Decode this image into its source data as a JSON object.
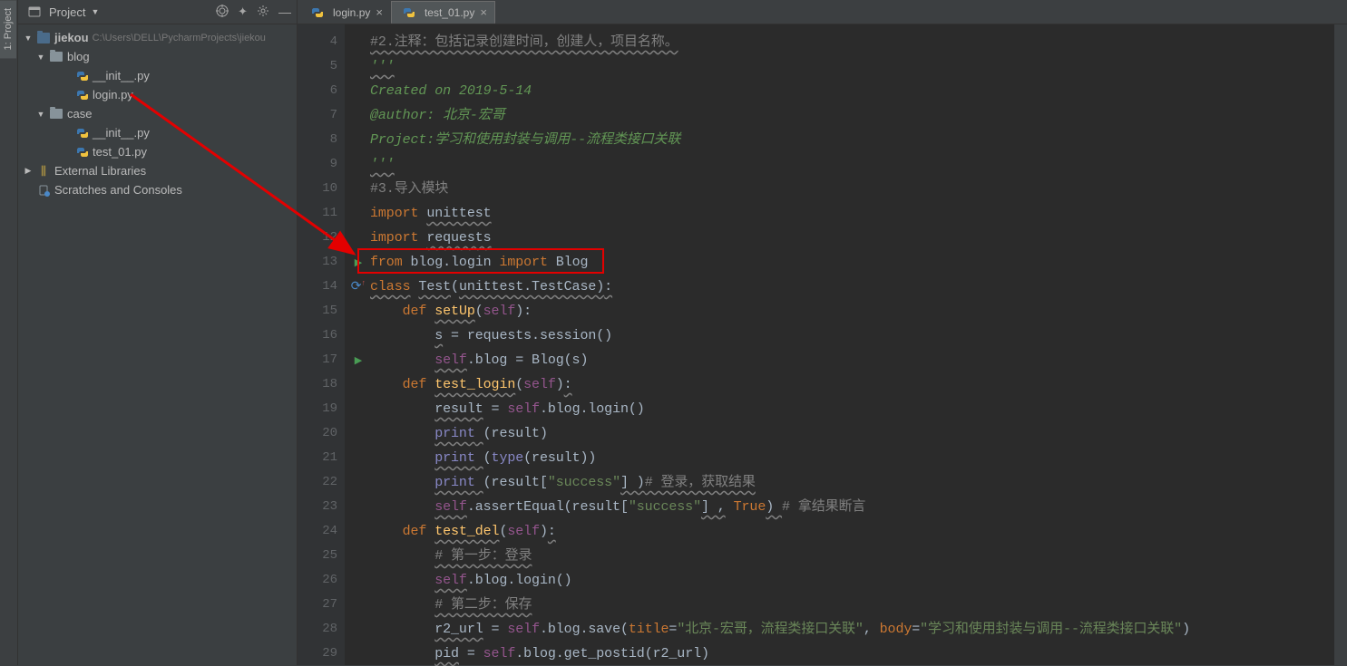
{
  "rail": {
    "projectLabel": "1: Project"
  },
  "projectHeader": {
    "title": "Project"
  },
  "tree": {
    "root": {
      "name": "jiekou",
      "path": "C:\\Users\\DELL\\PycharmProjects\\jiekou"
    },
    "blog": {
      "name": "blog",
      "files": [
        "__init__.py",
        "login.py"
      ]
    },
    "case": {
      "name": "case",
      "files": [
        "__init__.py",
        "test_01.py"
      ]
    },
    "external": "External Libraries",
    "scratches": "Scratches and Consoles"
  },
  "tabs": [
    {
      "label": "login.py",
      "active": false
    },
    {
      "label": "test_01.py",
      "active": true
    }
  ],
  "code": {
    "startLine": 4,
    "lines": [
      {
        "n": 4,
        "html": "<span class='c-comment wavy'>#2.注释：包括记录创建时间，创建人，项目名称。</span>"
      },
      {
        "n": 5,
        "html": "<span class='c-doc wavy'>'''</span>"
      },
      {
        "n": 6,
        "html": "<span class='c-doc'>Created on 2019-5-14</span>"
      },
      {
        "n": 7,
        "html": "<span class='c-doc'>@author: 北京-宏哥</span>"
      },
      {
        "n": 8,
        "html": "<span class='c-doc'>Project:学习和使用封装与调用--流程类接口关联</span>"
      },
      {
        "n": 9,
        "html": "<span class='c-doc wavy'>'''</span>"
      },
      {
        "n": 10,
        "html": "<span class='c-comment'>#3.导入模块</span>"
      },
      {
        "n": 11,
        "html": "<span class='c-kw'>import</span> <span class='c-text wavy'>unittest</span>"
      },
      {
        "n": 12,
        "html": "<span class='c-kw'>import</span> <span class='c-text wavy'>requests</span>"
      },
      {
        "n": 13,
        "html": "<span class='c-kw'>from</span> <span class='c-text'>blog.login</span> <span class='c-kw'>import</span> <span class='c-text'>Blog</span>"
      },
      {
        "n": 14,
        "html": "<span class='c-kw wavy'>class</span> <span class='c-text wavy'>Test</span><span class='c-text'>(</span><span class='c-text wavy'>unittest.TestCase)</span><span class='c-text wavy'>:</span>",
        "play": true
      },
      {
        "n": 15,
        "html": "    <span class='c-kw'>def</span> <span class='c-def wavy'>setUp</span><span class='c-text'>(</span><span class='c-self'>self</span><span class='c-text'>):</span>",
        "ovr": true
      },
      {
        "n": 16,
        "html": "        <span class='c-text wavy'>s</span> <span class='c-text'>= requests.session()</span>"
      },
      {
        "n": 17,
        "html": "        <span class='c-self wavy'>self</span><span class='c-text'>.blog = Blog(s)</span>"
      },
      {
        "n": 18,
        "html": "    <span class='c-kw'>def</span> <span class='c-def wavy'>test_login</span><span class='c-text'>(</span><span class='c-self'>self</span><span class='c-text'>)</span><span class='c-text wavy'>:</span>",
        "play": true
      },
      {
        "n": 19,
        "html": "        <span class='c-text wavy'>result</span> <span class='c-text'>= </span><span class='c-self'>self</span><span class='c-text'>.blog.login()</span>"
      },
      {
        "n": 20,
        "html": "        <span class='c-builtin wavy'>print</span><span class='c-text wavy'> </span><span class='c-text'>(result)</span>"
      },
      {
        "n": 21,
        "html": "        <span class='c-builtin wavy'>print</span><span class='c-text wavy'> </span><span class='c-text'>(</span><span class='c-builtin'>type</span><span class='c-text'>(result))</span>"
      },
      {
        "n": 22,
        "html": "        <span class='c-builtin wavy'>print</span><span class='c-text wavy'> </span><span class='c-text'>(result[</span><span class='c-str'>\"success\"</span><span class='c-text wavy'>] )</span><span class='c-comment wavy'># 登录，获取结果</span>"
      },
      {
        "n": 23,
        "html": "        <span class='c-self wavy'>self</span><span class='c-text'>.assertEqual(result[</span><span class='c-str'>\"success\"</span><span class='c-text wavy'>] ,</span> <span class='c-kw'>True</span><span class='c-text wavy'>) </span><span class='c-comment'># 拿结果断言</span>"
      },
      {
        "n": 24,
        "html": "    <span class='c-kw'>def</span> <span class='c-def wavy'>test_del</span><span class='c-text'>(</span><span class='c-self'>self</span><span class='c-text'>)</span><span class='c-text wavy'>:</span>"
      },
      {
        "n": 25,
        "html": "        <span class='c-comment wavy'># 第一步：登录</span>"
      },
      {
        "n": 26,
        "html": "        <span class='c-self wavy'>self</span><span class='c-text'>.blog.login()</span>"
      },
      {
        "n": 27,
        "html": "        <span class='c-comment wavy'># 第二步：保存</span>"
      },
      {
        "n": 28,
        "html": "        <span class='c-text wavy'>r2_url</span> <span class='c-text'>= </span><span class='c-self'>self</span><span class='c-text'>.blog.save(</span><span class='c-param'>title</span><span class='c-text'>=</span><span class='c-str'>\"北京-宏哥，流程类接口关联\"</span><span class='c-text'>, </span><span class='c-param'>body</span><span class='c-text'>=</span><span class='c-str'>\"学习和使用封装与调用--流程类接口关联\"</span><span class='c-text'>)</span>"
      },
      {
        "n": 29,
        "html": "        <span class='c-text wavy'>pid</span> <span class='c-text'>= </span><span class='c-self'>self</span><span class='c-text'>.blog.get_postid(r2_url)</span>"
      }
    ]
  },
  "annotations": {
    "highlightLine": 13
  }
}
